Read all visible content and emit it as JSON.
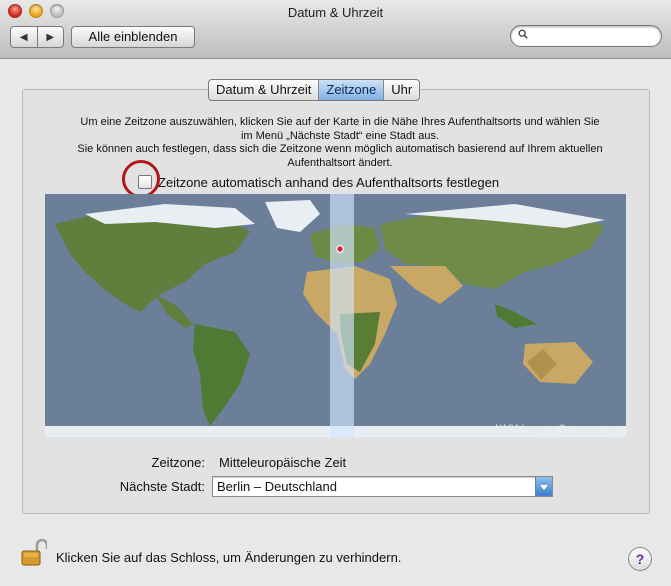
{
  "window": {
    "title": "Datum & Uhrzeit"
  },
  "toolbar": {
    "back_label": "◀",
    "forward_label": "▶",
    "show_all_label": "Alle einblenden",
    "search_placeholder": ""
  },
  "tabs": [
    {
      "label": "Datum & Uhrzeit",
      "active": false
    },
    {
      "label": "Zeitzone",
      "active": true
    },
    {
      "label": "Uhr",
      "active": false
    }
  ],
  "instructions": {
    "line1": "Um eine Zeitzone auszuwählen, klicken Sie auf der Karte in die Nähe Ihres Aufenthaltsorts und wählen Sie",
    "line2": "im Menü „Nächste Stadt“ eine Stadt aus.",
    "line3": "Sie können auch festlegen, dass sich die Zeitzone wenn möglich automatisch basierend auf Ihrem aktuellen",
    "line4": "Aufenthaltsort ändert."
  },
  "auto_timezone": {
    "label": "Zeitzone automatisch anhand des Aufenthaltsorts festlegen",
    "checked": false
  },
  "map": {
    "attribution": "NASA Imagery, Geonames.org",
    "ocean_color": "#6b7f98",
    "land_color": "#5f7f3d",
    "desert_color": "#c9a865",
    "ice_color": "#e9eef2",
    "highlight_color": "#d8e8ff",
    "marker_color": "#d9232e"
  },
  "fields": {
    "timezone_label": "Zeitzone:",
    "timezone_value": "Mitteleuropäische Zeit",
    "nearest_city_label": "Nächste Stadt:",
    "nearest_city_value": "Berlin – Deutschland"
  },
  "footer": {
    "lock_message": "Klicken Sie auf das Schloss, um Änderungen zu verhindern.",
    "help_label": "?"
  }
}
